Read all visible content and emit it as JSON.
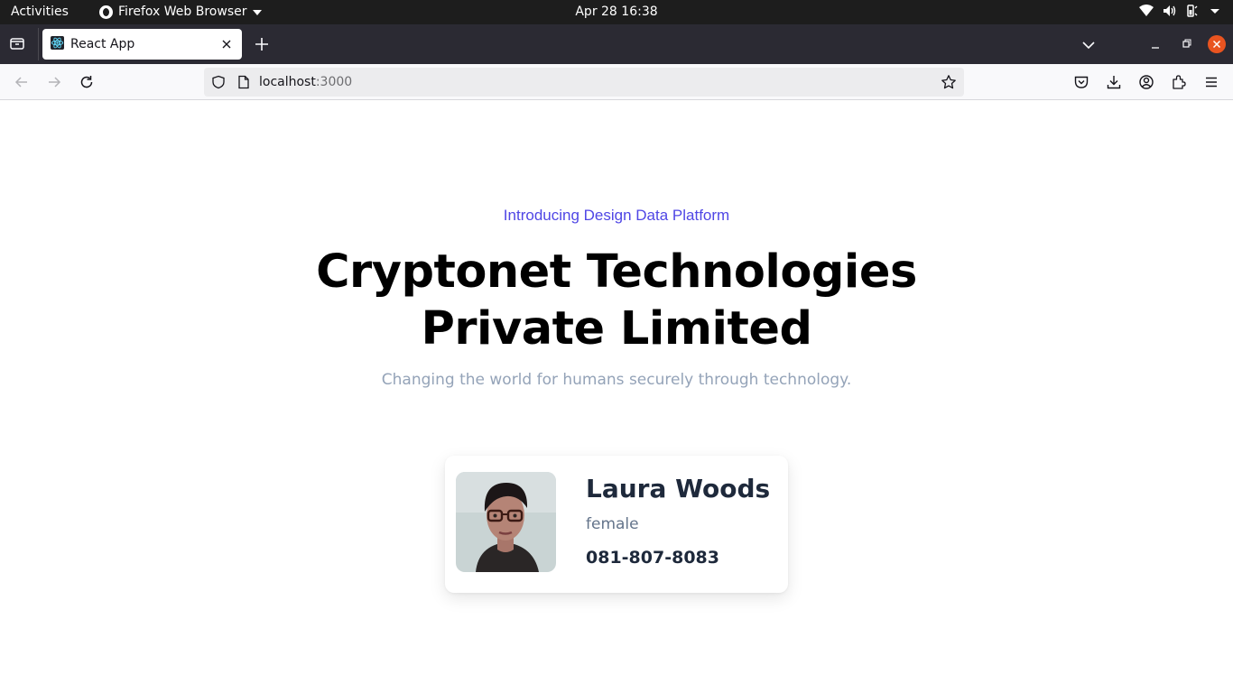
{
  "system_bar": {
    "activities": "Activities",
    "app_menu": "Firefox Web Browser",
    "clock": "Apr 28  16:38",
    "tray_icons": [
      "wifi-icon",
      "volume-icon",
      "battery-icon",
      "chevron-down-icon"
    ]
  },
  "browser": {
    "tab": {
      "title": "React App",
      "favicon": "react-icon"
    },
    "url": {
      "host": "localhost",
      "port": ":3000"
    },
    "toolbar_icons": [
      "back-icon",
      "forward-icon",
      "reload-icon",
      "pocket-icon",
      "download-icon",
      "account-icon",
      "extensions-icon",
      "menu-icon"
    ],
    "accent_close": "#e95420"
  },
  "page": {
    "eyebrow": "Introducing Design Data Platform",
    "headline_line1": "Cryptonet Technologies",
    "headline_line2": "Private Limited",
    "tagline": "Changing the world for humans securely through technology.",
    "colors": {
      "eyebrow": "#4f46e5",
      "tagline": "#94a3b8",
      "name": "#1e293b"
    }
  },
  "user_card": {
    "name": "Laura Woods",
    "gender": "female",
    "phone": "081-807-8083"
  }
}
